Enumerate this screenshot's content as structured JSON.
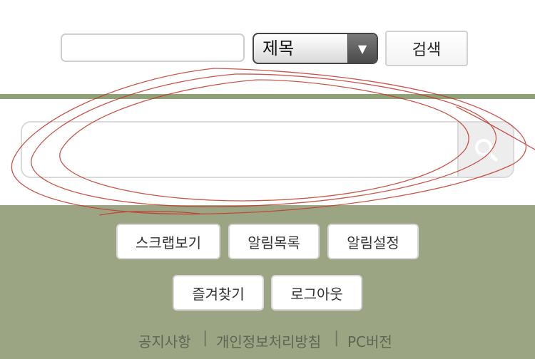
{
  "search_form": {
    "keyword_value": "",
    "field_selected": "제목",
    "search_label": "검색"
  },
  "global_search": {
    "value": "",
    "icon": "search-icon"
  },
  "menu": {
    "scrap_view": "스크랩보기",
    "notice_list": "알림목록",
    "notice_settings": "알림설정",
    "favorites": "즐겨찾기",
    "logout": "로그아웃"
  },
  "footer": {
    "notice": "공지사항",
    "privacy": "개인정보처리방침",
    "pc_version": "PC버전",
    "separator": "|"
  },
  "colors": {
    "accent_green": "#8fa277",
    "bottom_bg": "#9ca583",
    "scribble": "#c0392b"
  }
}
